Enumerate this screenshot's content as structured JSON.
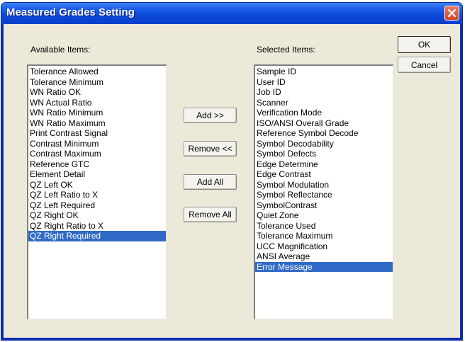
{
  "window": {
    "title": "Measured Grades Setting",
    "close_icon": "close-icon"
  },
  "available": {
    "label": "Available Items:",
    "items": [
      "Tolerance Allowed",
      "Tolerance Minimum",
      "WN Ratio OK",
      "WN Actual Ratio",
      "WN Ratio Minimum",
      "WN Ratio Maximum",
      "Print Contrast Signal",
      "Contrast Minimum",
      "Contrast Maximum",
      "Reference GTC",
      "Element Detail",
      "QZ Left OK",
      "QZ Left Ratio to X",
      "QZ Left Required",
      "QZ Right OK",
      "QZ Right Ratio to X",
      "QZ Right Required"
    ],
    "selected_item": "QZ Right Required"
  },
  "selected": {
    "label": "Selected Items:",
    "items": [
      "Sample ID",
      "User ID",
      "Job ID",
      "Scanner",
      "Verification Mode",
      "ISO/ANSI Overall Grade",
      "Reference Symbol Decode",
      "Symbol Decodability",
      "Symbol Defects",
      "Edge Determine",
      "Edge Contrast",
      "Symbol Modulation",
      "Symbol Reflectance",
      "SymbolContrast",
      "Quiet Zone",
      "Tolerance Used",
      "Tolerance Maximum",
      "UCC Magnification",
      "ANSI Average",
      "Error Message"
    ],
    "selected_item": "Error Message"
  },
  "buttons": {
    "add": "Add >>",
    "remove": "Remove <<",
    "add_all": "Add All",
    "remove_all": "Remove All",
    "ok": "OK",
    "cancel": "Cancel"
  },
  "colors": {
    "titlebar": "#0a47d8",
    "selection": "#3169c6",
    "dialog_face": "#ece9d8",
    "close_button": "#d2462a"
  }
}
